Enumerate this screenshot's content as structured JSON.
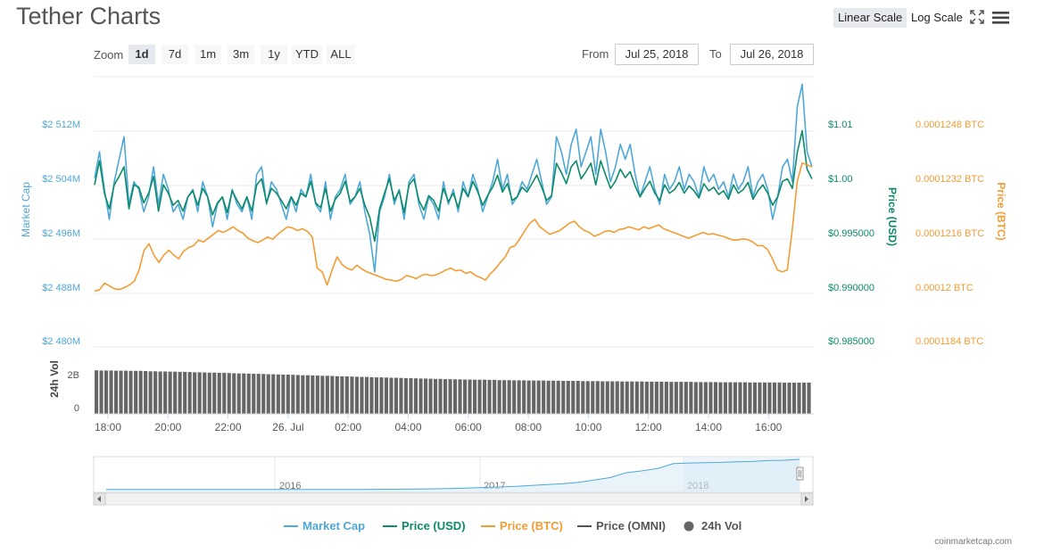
{
  "title": "Tether Charts",
  "scale_toggle": {
    "linear": "Linear Scale",
    "log": "Log Scale",
    "active": "linear"
  },
  "icons": {
    "fullscreen": "fullscreen-icon",
    "menu": "hamburger-menu-icon"
  },
  "zoom": {
    "label": "Zoom",
    "options": [
      "1d",
      "7d",
      "1m",
      "3m",
      "1y",
      "YTD",
      "ALL"
    ],
    "active": "1d"
  },
  "range": {
    "from_label": "From",
    "from_value": "Jul 25, 2018",
    "to_label": "To",
    "to_value": "Jul 26, 2018"
  },
  "colors": {
    "market_cap": "#4fa8d8",
    "price_usd": "#0d8a6a",
    "price_btc": "#f39c34",
    "price_omni": "#555555",
    "vol": "#666666"
  },
  "chart_data": {
    "type": "line",
    "x_ticks": [
      "18:00",
      "20:00",
      "22:00",
      "26. Jul",
      "02:00",
      "04:00",
      "06:00",
      "08:00",
      "10:00",
      "12:00",
      "14:00",
      "16:00"
    ],
    "axes": {
      "market_cap": {
        "label": "Market Cap",
        "ticks": [
          "$2 480M",
          "$2 488M",
          "$2 496M",
          "$2 504M",
          "$2 512M"
        ],
        "range": [
          2480,
          2516
        ]
      },
      "price_usd": {
        "label": "Price (USD)",
        "ticks": [
          "$0.985000",
          "$0.990000",
          "$0.995000",
          "$1.00",
          "$1.01"
        ],
        "range": [
          0.985,
          1.0075
        ]
      },
      "price_btc": {
        "label": "Price (BTC)",
        "ticks": [
          "0.0001184 BTC",
          "0.00012 BTC",
          "0.0001216 BTC",
          "0.0001232 BTC",
          "0.0001248 BTC"
        ],
        "range": [
          0.0001184,
          0.0001256
        ]
      },
      "volume": {
        "label": "24h Vol",
        "ticks": [
          "0",
          "2B"
        ]
      }
    },
    "series": [
      {
        "name": "Market Cap",
        "key": "market_cap",
        "values": [
          2502.5,
          2506,
          2501,
          2497,
          2502,
          2505,
          2508,
          2499,
          2502,
          2501,
          2498,
          2500,
          2504,
          2499,
          2503,
          2501,
          2498,
          2499,
          2497,
          2500,
          2501,
          2498,
          2502,
          2500,
          2496,
          2499,
          2500,
          2497,
          2501,
          2499,
          2498,
          2500,
          2497,
          2503,
          2504,
          2499,
          2502,
          2501,
          2499,
          2497,
          2500,
          2498,
          2501,
          2500,
          2503,
          2499,
          2498,
          2502,
          2497,
          2500,
          2501,
          2503,
          2499,
          2500,
          2502,
          2498,
          2495,
          2490,
          2498,
          2500,
          2503,
          2499,
          2501,
          2497,
          2502,
          2503,
          2499,
          2497,
          2500,
          2499,
          2497,
          2502,
          2499,
          2501,
          2498,
          2502,
          2500,
          2503,
          2501,
          2498,
          2500,
          2502,
          2505,
          2501,
          2503,
          2499,
          2500,
          2502,
          2501,
          2503,
          2505,
          2502,
          2499,
          2500,
          2508,
          2506,
          2503,
          2507,
          2509,
          2504,
          2506,
          2508,
          2503,
          2509,
          2506,
          2502,
          2504,
          2507,
          2505,
          2507,
          2503,
          2500,
          2502,
          2504,
          2501,
          2499,
          2503,
          2501,
          2502,
          2504,
          2501,
          2503,
          2502,
          2500,
          2504,
          2502,
          2503,
          2501,
          2502,
          2500,
          2503,
          2501,
          2502,
          2504,
          2500,
          2502,
          2503,
          2501,
          2497,
          2500,
          2504,
          2505,
          2502,
          2512,
          2515,
          2506,
          2504
        ]
      },
      {
        "name": "Price (USD)",
        "key": "price_usd",
        "values": [
          0.9985,
          1.0005,
          0.9978,
          0.9965,
          0.9985,
          0.9992,
          1.0,
          0.9965,
          0.9985,
          0.9983,
          0.997,
          0.9978,
          0.9992,
          0.9963,
          0.9985,
          0.9978,
          0.9968,
          0.9972,
          0.9963,
          0.9975,
          0.998,
          0.9968,
          0.9982,
          0.9975,
          0.996,
          0.997,
          0.9975,
          0.9962,
          0.998,
          0.9972,
          0.9965,
          0.9975,
          0.9963,
          0.9985,
          0.999,
          0.997,
          0.9982,
          0.9978,
          0.9972,
          0.9965,
          0.9975,
          0.9968,
          0.9978,
          0.9975,
          0.9988,
          0.997,
          0.9966,
          0.9982,
          0.9963,
          0.9973,
          0.9978,
          0.9988,
          0.9971,
          0.9975,
          0.9982,
          0.9968,
          0.9958,
          0.9938,
          0.9965,
          0.9978,
          0.999,
          0.9972,
          0.998,
          0.9962,
          0.9985,
          0.999,
          0.9972,
          0.9964,
          0.9976,
          0.9972,
          0.9963,
          0.9982,
          0.9971,
          0.9978,
          0.9966,
          0.9982,
          0.9975,
          0.9988,
          0.9979,
          0.9968,
          0.9976,
          0.9983,
          0.9993,
          0.9979,
          0.9986,
          0.9972,
          0.9975,
          0.9983,
          0.9979,
          0.9986,
          0.9993,
          0.9983,
          0.9972,
          0.9976,
          1.0003,
          0.9995,
          0.9986,
          1.0,
          1.0005,
          0.999,
          0.9996,
          1.0003,
          0.9985,
          1.0005,
          0.9993,
          0.9982,
          0.9988,
          0.9998,
          0.9991,
          0.9996,
          0.9984,
          0.9975,
          0.9982,
          0.9988,
          0.9978,
          0.9972,
          0.9985,
          0.9978,
          0.9981,
          0.9987,
          0.9978,
          0.9984,
          0.998,
          0.9974,
          0.9986,
          0.998,
          0.9983,
          0.9977,
          0.998,
          0.9973,
          0.9985,
          0.9978,
          0.9981,
          0.9987,
          0.9973,
          0.998,
          0.9985,
          0.9978,
          0.9968,
          0.9975,
          0.9988,
          0.999,
          0.9982,
          1.0012,
          1.003,
          0.9998,
          0.999
        ]
      },
      {
        "name": "Price (BTC)",
        "key": "price_btc",
        "values": [
          0.00011989,
          0.00011992,
          0.0001201,
          0.00012003,
          0.00011995,
          0.00011993,
          0.00011998,
          0.00012005,
          0.00012015,
          0.00012045,
          0.00012097,
          0.00012115,
          0.00012085,
          0.00012065,
          0.00012085,
          0.00012098,
          0.00012085,
          0.00012075,
          0.00012095,
          0.00012105,
          0.0001211,
          0.00012125,
          0.0001212,
          0.0001213,
          0.0001214,
          0.0001215,
          0.00012145,
          0.00012152,
          0.0001216,
          0.0001215,
          0.00012143,
          0.0001213,
          0.00012123,
          0.00012118,
          0.00012125,
          0.00012133,
          0.00012127,
          0.0001214,
          0.0001215,
          0.0001216,
          0.00012157,
          0.0001215,
          0.00012155,
          0.00012148,
          0.00012133,
          0.0001205,
          0.0001204,
          0.00012005,
          0.00012045,
          0.0001208,
          0.0001206,
          0.0001205,
          0.00012045,
          0.00012058,
          0.00012048,
          0.0001204,
          0.00012035,
          0.0001203,
          0.00012025,
          0.0001202,
          0.00012018,
          0.00012015,
          0.0001202,
          0.0001203,
          0.00012027,
          0.00012022,
          0.0001203,
          0.00012034,
          0.0001203,
          0.00012032,
          0.00012038,
          0.00012045,
          0.0001205,
          0.00012043,
          0.00012045,
          0.00012036,
          0.0001204,
          0.0001203,
          0.00012025,
          0.00012018,
          0.00012035,
          0.00012048,
          0.00012065,
          0.0001208,
          0.00012105,
          0.0001211,
          0.0001213,
          0.0001215,
          0.0001217,
          0.0001218,
          0.0001216,
          0.0001215,
          0.0001214,
          0.00012145,
          0.0001215,
          0.0001216,
          0.0001217,
          0.00012175,
          0.0001216,
          0.0001215,
          0.00012145,
          0.00012135,
          0.0001214,
          0.00012147,
          0.0001215,
          0.00012145,
          0.00012153,
          0.00012155,
          0.0001216,
          0.00012156,
          0.00012152,
          0.0001216,
          0.00012155,
          0.0001216,
          0.00012165,
          0.00012155,
          0.0001215,
          0.00012145,
          0.0001214,
          0.00012135,
          0.0001213,
          0.00012135,
          0.0001214,
          0.00012145,
          0.0001214,
          0.00012142,
          0.00012138,
          0.00012135,
          0.0001213,
          0.00012125,
          0.00012125,
          0.00012128,
          0.00012126,
          0.0001212,
          0.0001211,
          0.0001211,
          0.000121,
          0.00012075,
          0.00012045,
          0.0001204,
          0.00012045,
          0.0001215,
          0.0001228,
          0.0001233,
          0.00012325,
          0.0001232
        ]
      }
    ],
    "volume_values": [
      2.22,
      2.21,
      2.21,
      2.21,
      2.2,
      2.2,
      2.2,
      2.19,
      2.19,
      2.19,
      2.18,
      2.17,
      2.17,
      2.16,
      2.16,
      2.15,
      2.15,
      2.14,
      2.14,
      2.13,
      2.12,
      2.12,
      2.11,
      2.1,
      2.1,
      2.09,
      2.09,
      2.08,
      2.07,
      2.06,
      2.06,
      2.05,
      2.04,
      2.04,
      2.03,
      2.02,
      2.02,
      2.01,
      2.0,
      2.0,
      1.99,
      1.98,
      1.97,
      1.97,
      1.96,
      1.95,
      1.94,
      1.94,
      1.93,
      1.92,
      1.91,
      1.91,
      1.9,
      1.89,
      1.88,
      1.88,
      1.87,
      1.86,
      1.86,
      1.85,
      1.84,
      1.84,
      1.83,
      1.82,
      1.82,
      1.81,
      1.8,
      1.8,
      1.79,
      1.78,
      1.78,
      1.77,
      1.77,
      1.76,
      1.76,
      1.75,
      1.75,
      1.74,
      1.74,
      1.74,
      1.73,
      1.73,
      1.72,
      1.72,
      1.72,
      1.71,
      1.71,
      1.71,
      1.7,
      1.7,
      1.7,
      1.7,
      1.69,
      1.69,
      1.69,
      1.68,
      1.68,
      1.68,
      1.68,
      1.67,
      1.67,
      1.67,
      1.67,
      1.66,
      1.66,
      1.66,
      1.66,
      1.65,
      1.65,
      1.65,
      1.65,
      1.65,
      1.64,
      1.64,
      1.64,
      1.64,
      1.64,
      1.63,
      1.63,
      1.63,
      1.63,
      1.63,
      1.62,
      1.62,
      1.62,
      1.62,
      1.62,
      1.61,
      1.61,
      1.61,
      1.61,
      1.61,
      1.61,
      1.6,
      1.6,
      1.6,
      1.6,
      1.6,
      1.6,
      1.6,
      1.59,
      1.59,
      1.59,
      1.59,
      1.59,
      1.59
    ],
    "navigator": {
      "ticks": [
        "2016",
        "2017",
        "2018"
      ],
      "values": [
        0.006,
        0.006,
        0.006,
        0.006,
        0.006,
        0.006,
        0.006,
        0.006,
        0.006,
        0.006,
        0.006,
        0.006,
        0.007,
        0.008,
        0.008,
        0.009,
        0.01,
        0.012,
        0.014,
        0.017,
        0.022,
        0.03,
        0.04,
        0.055,
        0.075,
        0.09,
        0.11,
        0.14,
        0.17,
        0.2,
        0.24,
        0.32,
        0.4,
        0.56,
        0.62,
        0.7,
        0.86,
        0.88,
        0.89,
        0.9,
        0.92,
        0.93,
        0.96,
        0.97,
        1.0
      ]
    },
    "legend": [
      "Market Cap",
      "Price (USD)",
      "Price (BTC)",
      "Price (OMNI)",
      "24h Vol"
    ]
  },
  "footer": "coinmarketcap.com"
}
